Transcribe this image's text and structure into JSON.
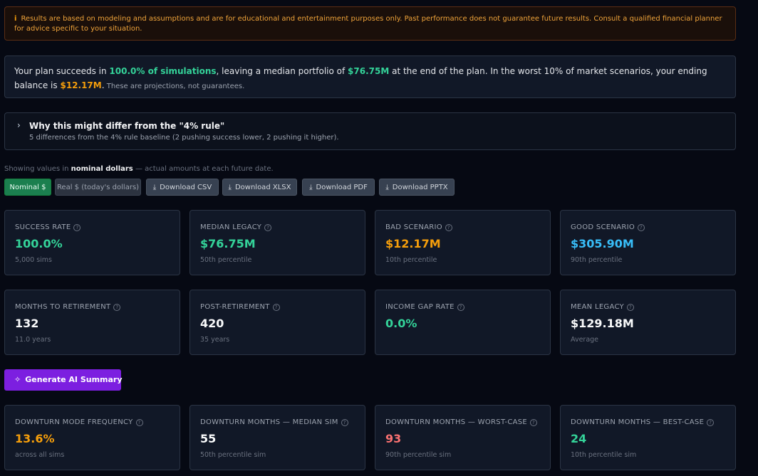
{
  "disclaimer": {
    "icon": "info-icon",
    "text": "Results are based on modeling and assumptions and are for educational and entertainment purposes only. Past performance does not guarantee future results. Consult a qualified financial planner for advice specific to your situation."
  },
  "summary": {
    "part1": "Your plan succeeds in ",
    "success_pct": "100.0% of simulations",
    "part2": ", leaving a median portfolio of ",
    "median": "$76.75M",
    "part3": " at the end of the plan. In the worst 10% of market scenarios, your ending balance is ",
    "worst": "$12.17M",
    "part4": ".",
    "note": " These are projections, not guarantees."
  },
  "why": {
    "title": "Why this might differ from the \"4% rule\"",
    "subtitle": "5 differences from the 4% rule baseline (2 pushing success lower, 2 pushing it higher)."
  },
  "showing": {
    "prefix": "Showing values in ",
    "mode": "nominal dollars",
    "suffix": " — actual amounts at each future date."
  },
  "buttons": {
    "nominal": "Nominal $",
    "real": "Real $ (today's dollars)",
    "csv": "Download CSV",
    "xlsx": "Download XLSX",
    "pdf": "Download PDF",
    "pptx": "Download PPTX"
  },
  "cards_row1": [
    {
      "label": "SUCCESS RATE",
      "value": "100.0%",
      "caption": "5,000 sims",
      "color": "#34d399"
    },
    {
      "label": "MEDIAN LEGACY",
      "value": "$76.75M",
      "caption": "50th percentile",
      "color": "#34d399"
    },
    {
      "label": "BAD SCENARIO",
      "value": "$12.17M",
      "caption": "10th percentile",
      "color": "#f59e0b"
    },
    {
      "label": "GOOD SCENARIO",
      "value": "$305.90M",
      "caption": "90th percentile",
      "color": "#38bdf8"
    }
  ],
  "cards_row2": [
    {
      "label": "MONTHS TO RETIREMENT",
      "value": "132",
      "caption": "11.0 years"
    },
    {
      "label": "POST-RETIREMENT",
      "value": "420",
      "caption": "35 years"
    },
    {
      "label": "INCOME GAP RATE",
      "value": "0.0%",
      "caption": "",
      "color": "#34d399"
    },
    {
      "label": "MEAN LEGACY",
      "value": "$129.18M",
      "caption": "Average"
    }
  ],
  "ai_button": "Generate AI Summary",
  "cards_row3": [
    {
      "label": "DOWNTURN MODE FREQUENCY",
      "value": "13.6%",
      "caption": "across all sims",
      "color": "#f59e0b"
    },
    {
      "label": "DOWNTURN MONTHS — MEDIAN SIM",
      "value": "55",
      "caption": "50th percentile sim"
    },
    {
      "label": "DOWNTURN MONTHS — WORST-CASE",
      "value": "93",
      "caption": "90th percentile sim",
      "color": "#f87171"
    },
    {
      "label": "DOWNTURN MONTHS — BEST-CASE",
      "value": "24",
      "caption": "10th percentile sim",
      "color": "#34d399"
    }
  ]
}
